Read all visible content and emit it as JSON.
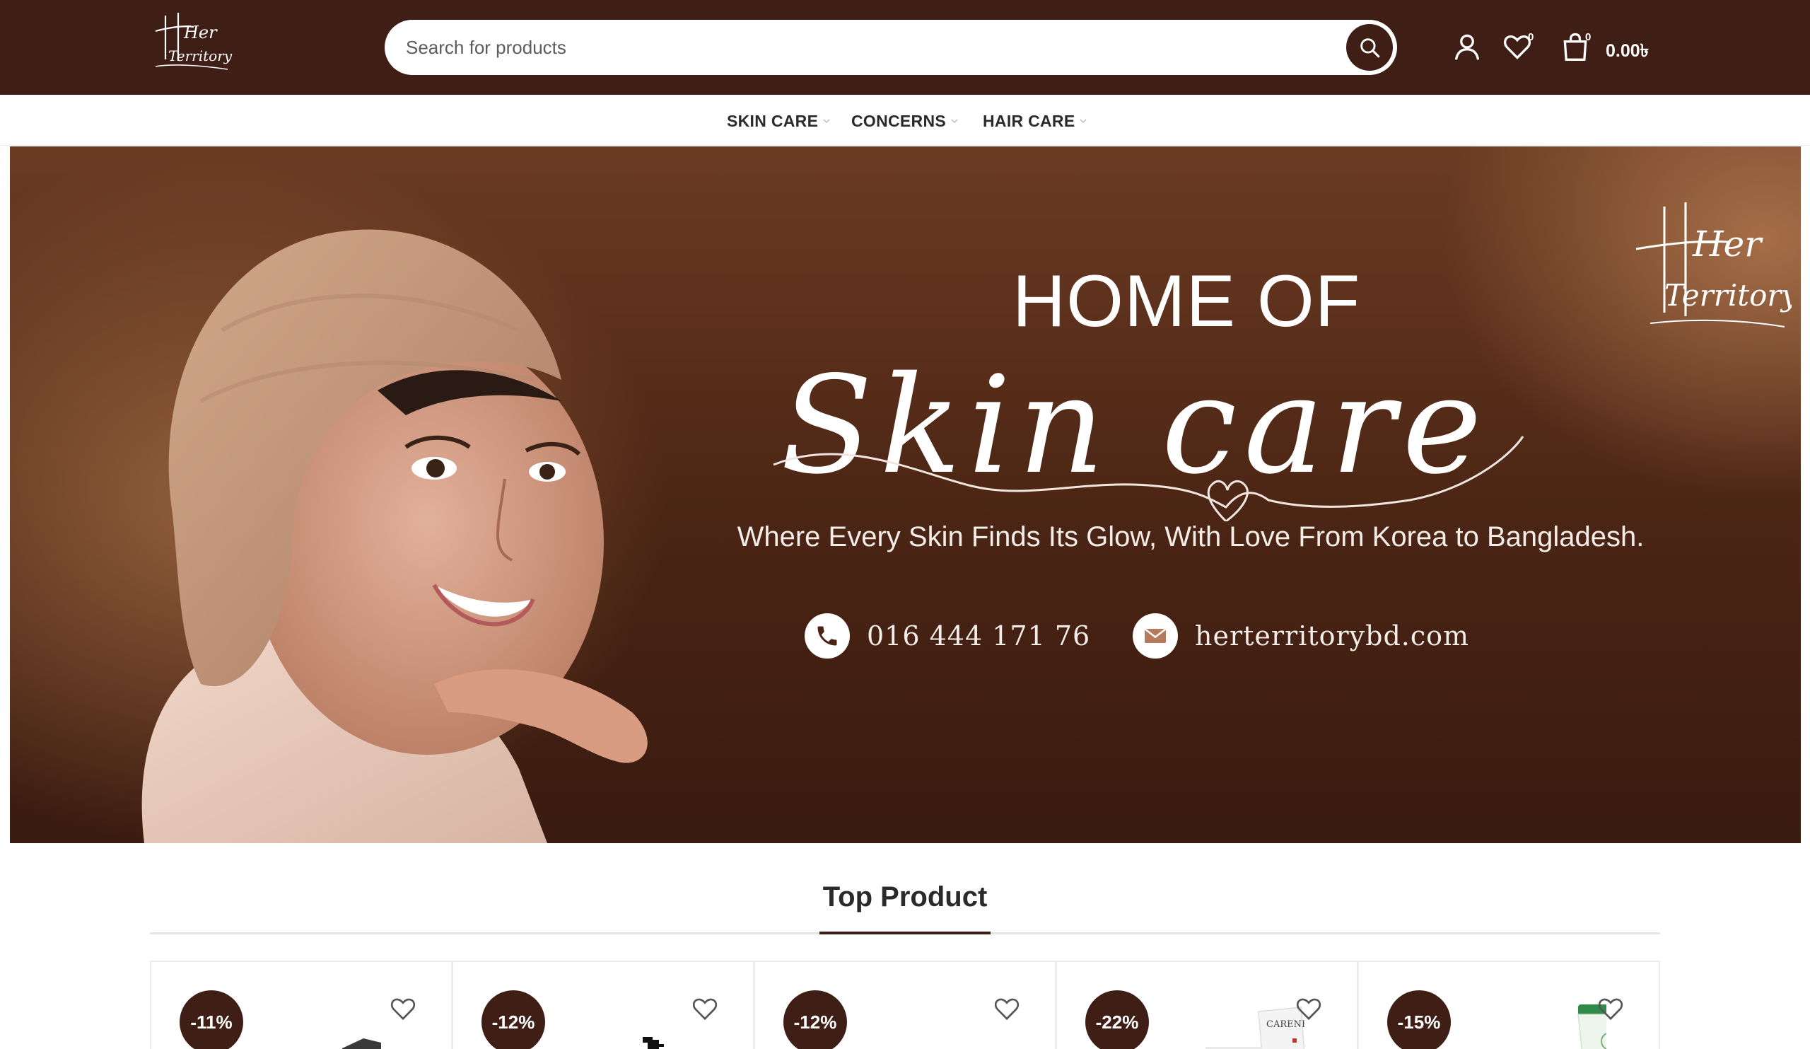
{
  "header": {
    "logo_text_top": "Her",
    "logo_text_bottom": "Territory",
    "search_placeholder": "Search for products",
    "wishlist_count": "0",
    "cart_count": "0",
    "cart_total": "0.00৳"
  },
  "nav": {
    "items": [
      {
        "label": "SKIN CARE"
      },
      {
        "label": "CONCERNS"
      },
      {
        "label": "HAIR CARE"
      }
    ]
  },
  "hero": {
    "title_line1": "HOME OF",
    "title_line2": "Skin care",
    "tagline": "Where Every Skin Finds Its Glow, With Love From Korea to Bangladesh.",
    "phone": "016 444 171 76",
    "website": "herterritorybd.com"
  },
  "section": {
    "title": "Top Product"
  },
  "products": [
    {
      "discount": "-11%"
    },
    {
      "discount": "-12%"
    },
    {
      "discount": "-12%"
    },
    {
      "discount": "-22%",
      "brand": "CARENEL"
    },
    {
      "discount": "-15%"
    }
  ],
  "colors": {
    "brand_dark": "#3f1e16",
    "hero_brown": "#5a2e1a",
    "white": "#ffffff"
  }
}
